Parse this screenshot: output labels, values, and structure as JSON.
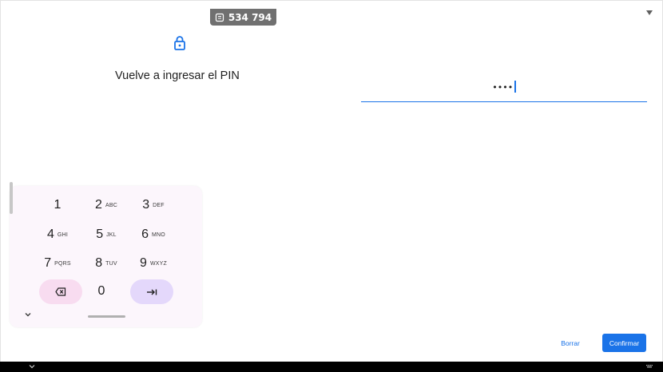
{
  "notification": {
    "code": "534 794",
    "icon": "message-icon"
  },
  "status": {
    "icon": "wifi-icon"
  },
  "lock": {
    "icon": "lock-icon"
  },
  "prompt": {
    "text": "Vuelve a ingresar el PIN"
  },
  "pin_field": {
    "masked_value": "••••"
  },
  "keypad": {
    "rows": [
      [
        {
          "digit": "1",
          "letters": ""
        },
        {
          "digit": "2",
          "letters": "ABC"
        },
        {
          "digit": "3",
          "letters": "DEF"
        }
      ],
      [
        {
          "digit": "4",
          "letters": "GHI"
        },
        {
          "digit": "5",
          "letters": "JKL"
        },
        {
          "digit": "6",
          "letters": "MNO"
        }
      ],
      [
        {
          "digit": "7",
          "letters": "PQRS"
        },
        {
          "digit": "8",
          "letters": "TUV"
        },
        {
          "digit": "9",
          "letters": "WXYZ"
        }
      ]
    ],
    "zero": "0",
    "backspace_icon": "backspace-icon",
    "enter_icon": "tab-arrow-icon",
    "collapse_icon": "chevron-down-icon",
    "colors": {
      "backspace_bg": "#f8dcf0",
      "enter_bg": "#e4d8fb",
      "panel_bg": "#fcf6fc"
    }
  },
  "actions": {
    "clear_label": "Borrar",
    "confirm_label": "Confirmar"
  },
  "colors": {
    "accent": "#1a73e8",
    "chip_bg": "#707070"
  },
  "system_nav": {
    "back_icon": "chevron-down-icon",
    "keyboard_icon": "keyboard-icon"
  }
}
